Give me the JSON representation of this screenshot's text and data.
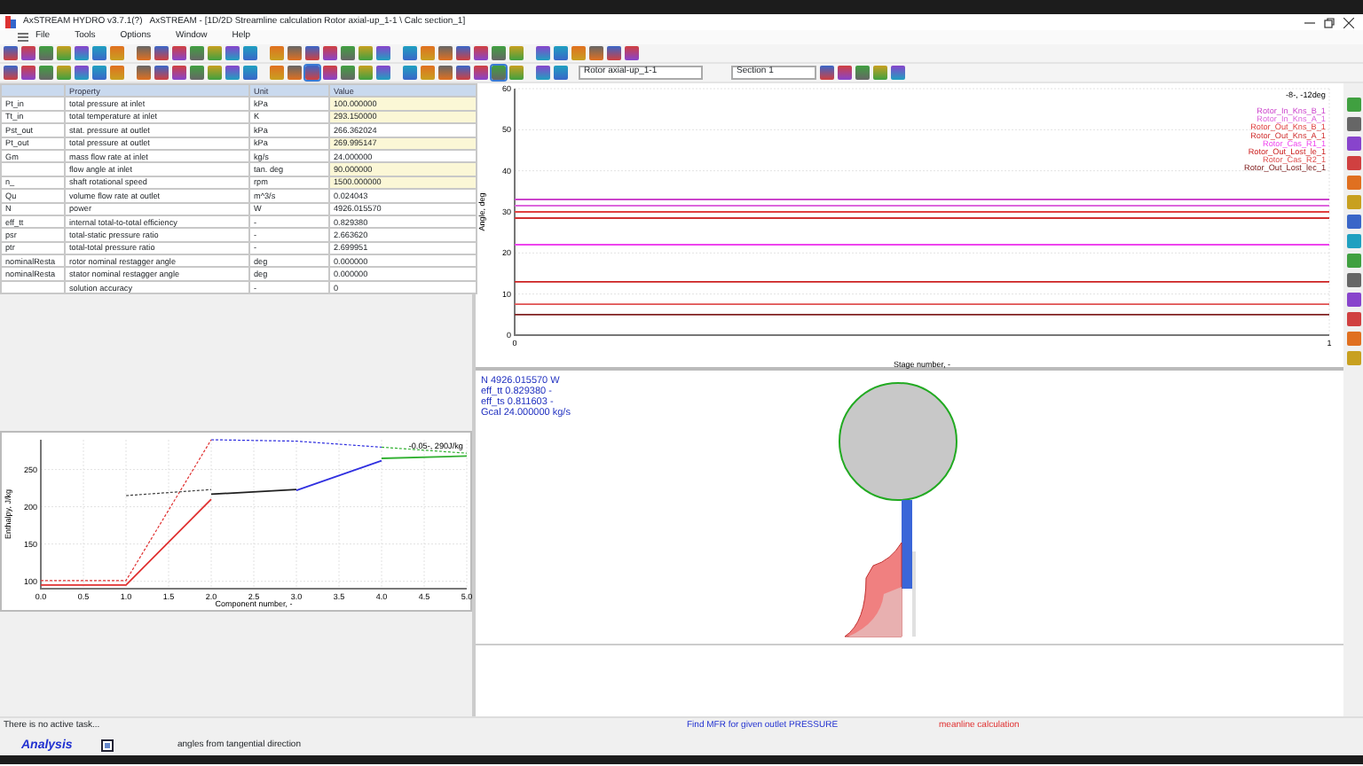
{
  "window": {
    "app": "AxSTREAM HYDRO v3.7.1(?)",
    "title": "AxSTREAM - [1D/2D Streamline calculation  Rotor axial-up_1-1 \\ Calc section_1]"
  },
  "menu": [
    "File",
    "Tools",
    "Options",
    "Window",
    "Help"
  ],
  "toolbar": {
    "rotor": "Rotor axial-up_1-1",
    "section": "Section 1"
  },
  "table": {
    "columns": [
      "Property",
      "Unit",
      "Value"
    ],
    "rows": [
      {
        "symbol": "Pt_in",
        "property": "total pressure at inlet",
        "unit": "kPa",
        "value": "100.000000",
        "input": true
      },
      {
        "symbol": "Tt_in",
        "property": "total temperature at inlet",
        "unit": "K",
        "value": "293.150000",
        "input": true
      },
      {
        "symbol": "Pst_out",
        "property": "stat. pressure at outlet",
        "unit": "kPa",
        "value": "266.362024",
        "input": false
      },
      {
        "symbol": "Pt_out",
        "property": "total pressure at outlet",
        "unit": "kPa",
        "value": "269.995147",
        "input": true
      },
      {
        "symbol": "Gm",
        "property": "mass flow rate at inlet",
        "unit": "kg/s",
        "value": "24.000000",
        "input": false
      },
      {
        "symbol": "",
        "property": "flow angle at inlet",
        "unit": "tan. deg",
        "value": "90.000000",
        "input": true
      },
      {
        "symbol": "n_",
        "property": "shaft rotational speed",
        "unit": "rpm",
        "value": "1500.000000",
        "input": true
      },
      {
        "symbol": "Qu",
        "property": "volume flow rate at outlet",
        "unit": "m^3/s",
        "value": "0.024043",
        "input": false
      },
      {
        "symbol": "N",
        "property": "power",
        "unit": "W",
        "value": "4926.015570",
        "input": false
      },
      {
        "symbol": "eff_tt",
        "property": "internal total-to-total efficiency",
        "unit": "-",
        "value": "0.829380",
        "input": false
      },
      {
        "symbol": "psr",
        "property": "total-static pressure ratio",
        "unit": "-",
        "value": "2.663620",
        "input": false
      },
      {
        "symbol": "ptr",
        "property": "total-total pressure ratio",
        "unit": "-",
        "value": "2.699951",
        "input": false
      },
      {
        "symbol": "nominalResta",
        "property": "rotor nominal restagger angle",
        "unit": "deg",
        "value": "0.000000",
        "input": false
      },
      {
        "symbol": "nominalResta",
        "property": "stator nominal restagger angle",
        "unit": "deg",
        "value": "0.000000",
        "input": false
      },
      {
        "symbol": "",
        "property": "solution accuracy",
        "unit": "-",
        "value": "0",
        "input": false
      }
    ]
  },
  "enthalpy_chart": {
    "chart_data": {
      "type": "line",
      "xlabel": "Component number, -",
      "ylabel": "Enthalpy, J/kg",
      "x": [
        0,
        1,
        2,
        3,
        4,
        5
      ],
      "xlim": [
        0,
        5
      ],
      "ylim": [
        90,
        290
      ],
      "xticks": [
        {
          "value": 0,
          "label": "0.0"
        },
        {
          "value": 0.5,
          "label": "0.5"
        },
        {
          "value": 1,
          "label": "1.0"
        },
        {
          "value": 1.5,
          "label": "1.5"
        },
        {
          "value": 2,
          "label": "2.0"
        },
        {
          "value": 2.5,
          "label": "2.5"
        },
        {
          "value": 3,
          "label": "3.0"
        },
        {
          "value": 3.5,
          "label": "3.5"
        },
        {
          "value": 4,
          "label": "4.0"
        },
        {
          "value": 4.5,
          "label": "4.5"
        },
        {
          "value": 5,
          "label": "5.0"
        }
      ],
      "yticks": [
        100,
        150,
        200,
        250
      ],
      "series": [
        {
          "color": "#e03030",
          "line_style": "solid",
          "values": [
            95,
            95,
            210,
            null,
            null,
            null
          ]
        },
        {
          "color": "#202020",
          "line_style": "solid",
          "values": [
            null,
            null,
            217,
            223,
            null,
            null
          ]
        },
        {
          "color": "#3030e0",
          "line_style": "solid",
          "values": [
            null,
            null,
            null,
            222,
            262,
            null
          ]
        },
        {
          "color": "#30b030",
          "line_style": "solid",
          "values": [
            null,
            null,
            null,
            null,
            265,
            268
          ]
        },
        {
          "color": "#e03030",
          "line_style": "dashed",
          "values": [
            101,
            101,
            290,
            null,
            null,
            null
          ]
        },
        {
          "color": "#3030e0",
          "line_style": "dashed",
          "values": [
            null,
            null,
            290,
            288,
            280,
            null
          ]
        },
        {
          "color": "#30b030",
          "line_style": "dashed",
          "values": [
            null,
            null,
            null,
            null,
            280,
            272
          ]
        },
        {
          "color": "#404040",
          "line_style": "dashed",
          "values": [
            null,
            215,
            223,
            null,
            null,
            null
          ]
        }
      ],
      "grid": true,
      "annotations": [
        {
          "text": "-0.05-, 290J/kg"
        }
      ]
    }
  },
  "angle_chart": {
    "chart_data": {
      "type": "line",
      "xlabel": "Stage number, -",
      "ylabel": "Angle, deg",
      "x": [
        0,
        1
      ],
      "xlim": [
        0,
        1
      ],
      "ylim": [
        0,
        60
      ],
      "xticks": [
        0,
        1
      ],
      "yticks": [
        0,
        10,
        20,
        30,
        40,
        50,
        60
      ],
      "series": [
        {
          "name": "Rotor_In_Kns_B_1",
          "color": "#cc44cc",
          "values": [
            33,
            33
          ]
        },
        {
          "name": "Rotor_In_Kns_A_1",
          "color": "#dd66dd",
          "values": [
            31.5,
            31.5
          ]
        },
        {
          "name": "Rotor_Out_Kns_B_1",
          "color": "#e04040",
          "values": [
            30,
            30
          ]
        },
        {
          "name": "Rotor_Out_Kns_A_1",
          "color": "#d03030",
          "values": [
            28.5,
            28.5
          ]
        },
        {
          "name": "Rotor_Cas_R1_1",
          "color": "#ee44ee",
          "values": [
            22,
            22
          ]
        },
        {
          "name": "Rotor_Out_Lost_le_1",
          "color": "#cc2020",
          "values": [
            13,
            13
          ]
        },
        {
          "name": "Rotor_Cas_R2_1",
          "color": "#e05050",
          "values": [
            7.5,
            7.5
          ]
        },
        {
          "name": "Rotor_Out_Lost_lec_1",
          "color": "#802020",
          "values": [
            5,
            5
          ]
        }
      ],
      "grid": true,
      "annotations": [
        {
          "text": "-8-, -12deg"
        }
      ]
    }
  },
  "results": [
    "N 4926.015570 W",
    "eff_tt 0.829380 -",
    "eff_ts 0.811603 -",
    "Gcal 24.000000 kg/s"
  ],
  "status_bar": {
    "task": "There is no active task...",
    "mode": "Find MFR for given outlet PRESSURE",
    "calc": "meanline calculation",
    "tab": "Analysis",
    "hint": "angles from tangential direction"
  }
}
